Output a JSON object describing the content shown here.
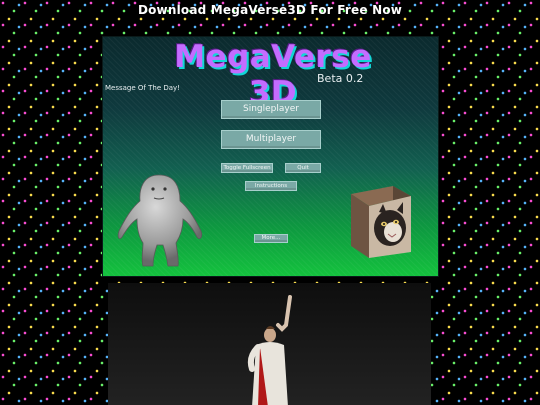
{
  "header": {
    "download_link": "Download MegaVerse3D For Free Now"
  },
  "game": {
    "title": "MegaVerse 3D",
    "version": "Beta 0.2",
    "motd_label": "Message Of The Day!",
    "buttons": {
      "singleplayer": "Singleplayer",
      "multiplayer": "Multiplayer",
      "toggle_fullscreen": "Toggle Fullscreen",
      "quit": "Quit",
      "instructions": "Instructions",
      "more": "More..."
    }
  },
  "colors": {
    "page_background": "#000000",
    "logo_fill": "#c46cff",
    "logo_shadow": "#12d6d6",
    "button_fill": "#7aa9a6",
    "frame_gradient_top": "#0b2a2e",
    "frame_gradient_bottom": "#14c23e"
  },
  "icons": {
    "creature": "gray-blob-creature-icon",
    "cube": "cat-face-cube-icon",
    "figure": "robed-figure-waving-icon"
  }
}
